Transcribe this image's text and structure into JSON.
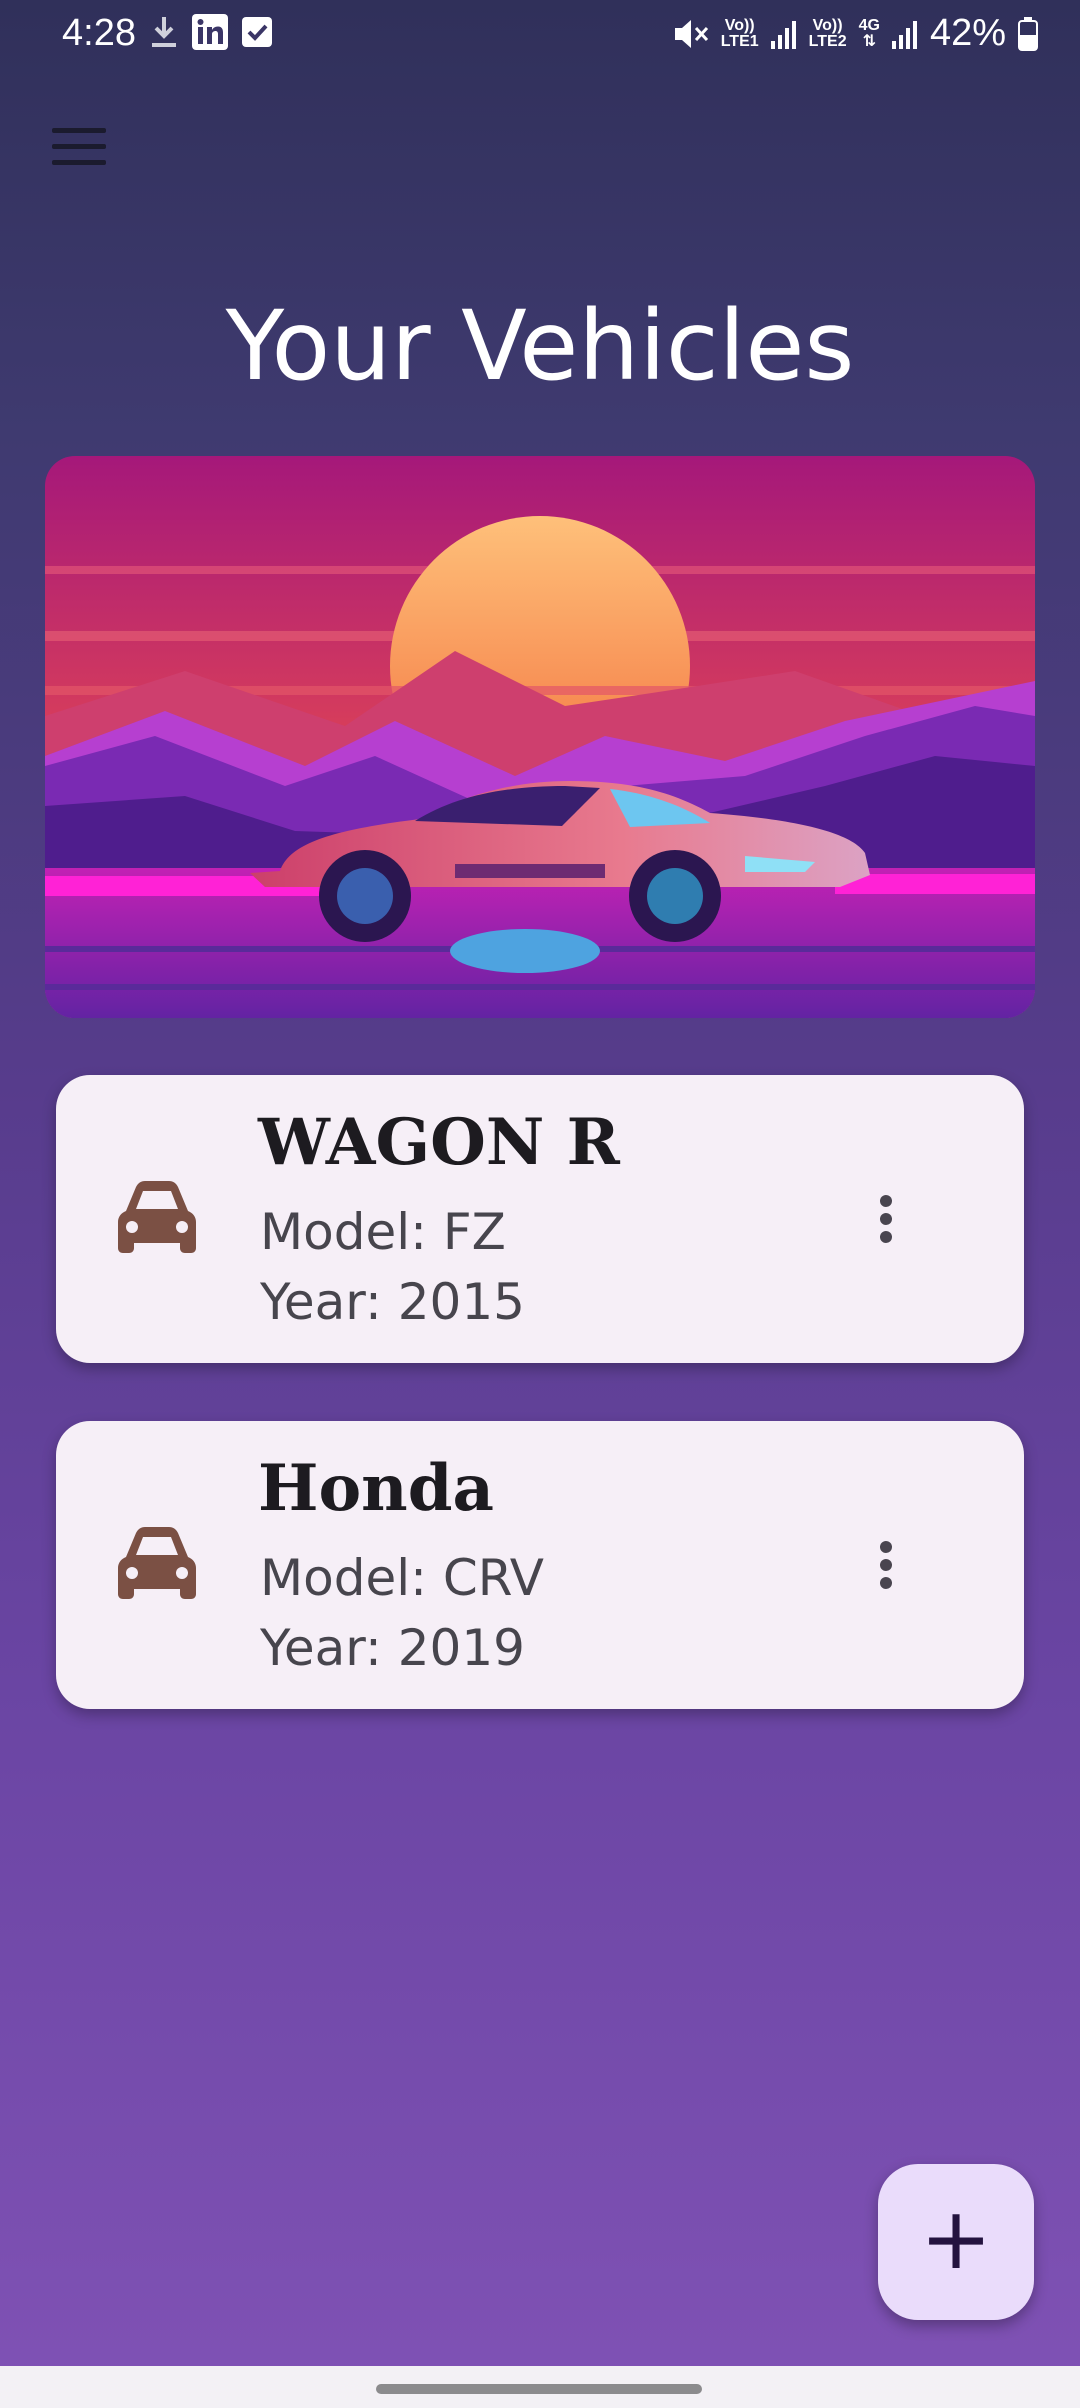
{
  "status_bar": {
    "time": "4:28",
    "sim1_volte": "Vo))",
    "sim1_label": "LTE1",
    "sim2_volte": "Vo))",
    "sim2_label": "LTE2",
    "network": "4G",
    "battery": "42%",
    "icons": [
      "download-icon",
      "linkedin-icon",
      "checkbox-icon",
      "mute-icon",
      "signal-icon",
      "battery-icon"
    ]
  },
  "header": {
    "menu_icon": "hamburger-menu-icon",
    "title": "Your Vehicles"
  },
  "hero": {
    "image": "car-sunset-illustration"
  },
  "vehicles": [
    {
      "name": "WAGON R",
      "model": "Model: FZ",
      "year": "Year: 2015",
      "icon": "car-icon",
      "menu_icon": "more-vert-icon"
    },
    {
      "name": "Honda",
      "model": "Model: CRV",
      "year": "Year: 2019",
      "icon": "car-icon",
      "menu_icon": "more-vert-icon"
    }
  ],
  "fab": {
    "label": "+",
    "icon": "add-icon"
  },
  "colors": {
    "card_bg": "#f6eff7",
    "car_icon": "#7b5044",
    "fab_bg": "#eadcfb"
  }
}
